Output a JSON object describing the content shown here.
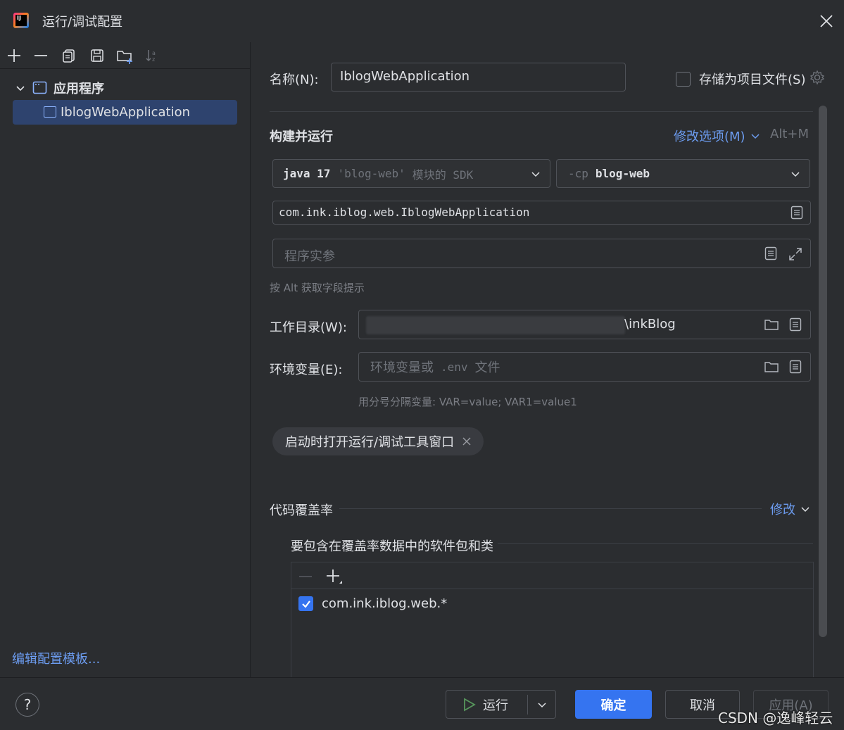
{
  "window": {
    "title": "运行/调试配置"
  },
  "sidebar": {
    "tree_root": "应用程序",
    "tree_item": "IblogWebApplication",
    "edit_templates": "编辑配置模板..."
  },
  "form": {
    "name_label": "名称(N):",
    "name_value": "IblogWebApplication",
    "store_as_project": "存储为项目文件(S)",
    "build_run_title": "构建并运行",
    "modify_options": "修改选项(M)",
    "modify_shortcut": "Alt+M",
    "sdk_java": "java 17",
    "sdk_module": "'blog-web'",
    "sdk_suffix": "模块的 SDK",
    "cp_flag": "-cp",
    "cp_value": "blog-web",
    "main_class": "com.ink.iblog.web.IblogWebApplication",
    "program_args_placeholder": "程序实参",
    "alt_hint": "按 Alt 获取字段提示",
    "workdir_label": "工作目录(W):",
    "workdir_value": "\\inkBlog",
    "env_label": "环境变量(E):",
    "env_placeholder_a": "环境变量或",
    "env_placeholder_b": ".env",
    "env_placeholder_c": "文件",
    "env_hint": "用分号分隔变量: VAR=value; VAR1=value1",
    "chip_label": "启动时打开运行/调试工具窗口",
    "coverage_title": "代码覆盖率",
    "coverage_modify": "修改",
    "coverage_subtitle": "要包含在覆盖率数据中的软件包和类",
    "coverage_items": [
      "com.ink.iblog.web.*"
    ]
  },
  "buttons": {
    "run": "运行",
    "ok": "确定",
    "cancel": "取消",
    "apply": "应用(A)"
  },
  "watermark": "CSDN @逸峰轻云",
  "colors": {
    "background": "#2b2d30",
    "accent": "#3574f0",
    "link": "#6c9cf0",
    "selection": "#2e436e"
  }
}
